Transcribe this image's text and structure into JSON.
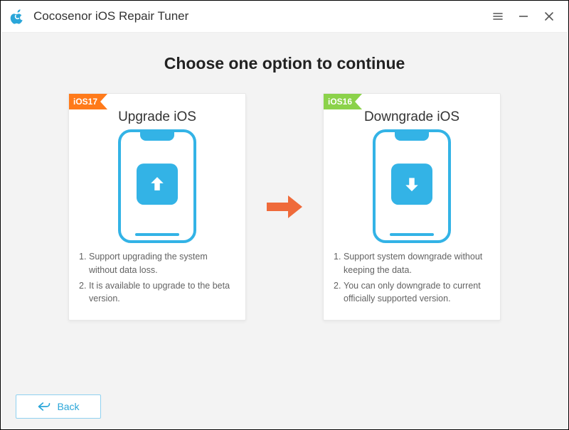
{
  "app": {
    "title": "Cocosenor iOS Repair Tuner"
  },
  "heading": "Choose one option to continue",
  "options": {
    "upgrade": {
      "ribbon": "iOS17",
      "title": "Upgrade iOS",
      "desc1": "Support upgrading the system without data loss.",
      "desc2": "It is available to upgrade to the beta version."
    },
    "downgrade": {
      "ribbon": "iOS16",
      "title": "Downgrade iOS",
      "desc1": "Support system downgrade without keeping the data.",
      "desc2": "You can only downgrade to current officially supported version."
    }
  },
  "back": {
    "label": "Back"
  },
  "colors": {
    "accent": "#33b3e6",
    "ribbon_upgrade": "#ff7a1a",
    "ribbon_downgrade": "#8bd24a",
    "arrow": "#ef6a3a"
  }
}
